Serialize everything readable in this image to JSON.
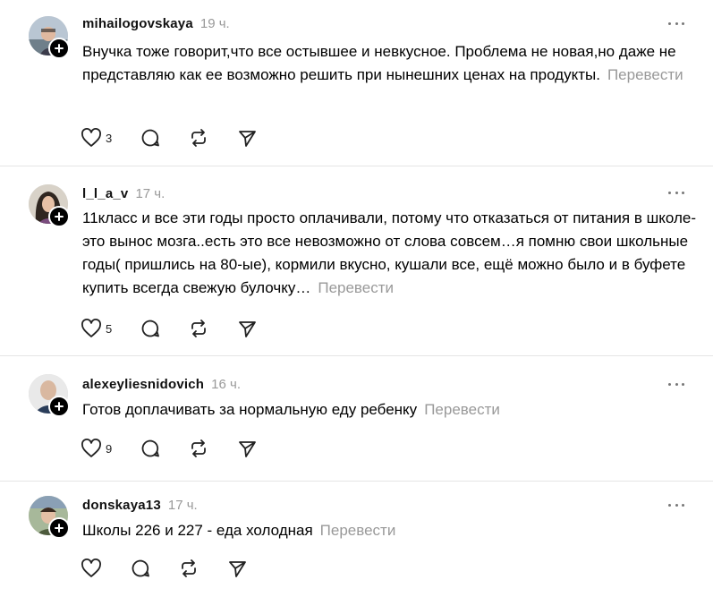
{
  "posts": [
    {
      "username": "mihailogovskaya",
      "time": "19 ч.",
      "text": "Внучка тоже говорит,что все остывшее и невкусное. Проблема не новая,но даже не представляю как ее возможно решить при нынешних ценах на продукты.",
      "translate": "Перевести",
      "likes": "3"
    },
    {
      "username": "l_l_a_v",
      "time": "17 ч.",
      "text": "11класс и все эти годы просто оплачивали, потому что отказаться от питания в школе-это вынос мозга..есть это все невозможно от слова совсем…я помню свои школьные годы( пришлись на 80-ые), кормили вкусно, кушали все, ещё можно было и в буфете купить всегда свежую булочку…",
      "translate": "Перевести",
      "likes": "5"
    },
    {
      "username": "alexeyliesnidovich",
      "time": "16 ч.",
      "text": "Готов доплачивать за нормальную еду ребенку",
      "translate": "Перевести",
      "likes": "9"
    },
    {
      "username": "donskaya13",
      "time": "17 ч.",
      "text": "Школы 226 и 227 - еда холодная",
      "translate": "Перевести",
      "likes": ""
    }
  ],
  "icons": {
    "like": "heart-icon",
    "reply": "comment-icon",
    "repost": "repost-icon",
    "share": "send-icon",
    "more": "more-dots-icon",
    "follow": "plus-icon"
  },
  "colors": {
    "muted": "#999999",
    "divider": "#e5e5e5",
    "text": "#000000"
  }
}
